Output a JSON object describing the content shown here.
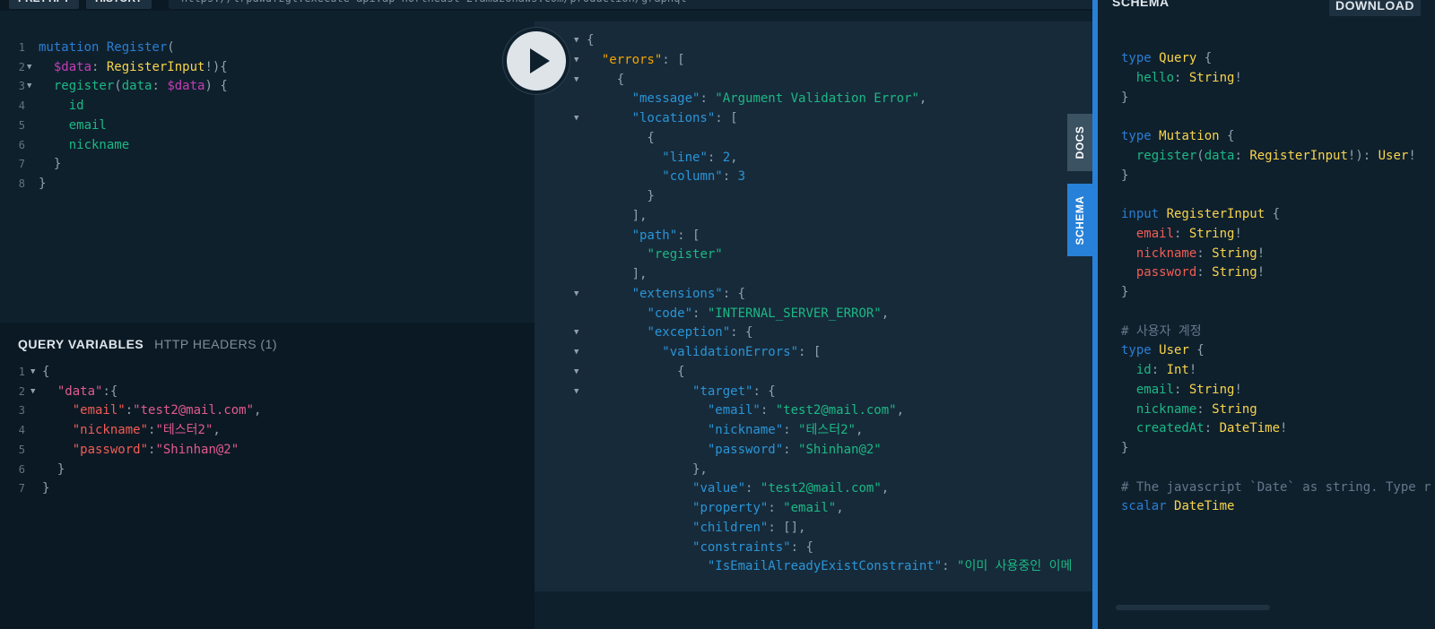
{
  "topbar": {
    "prettify": "PRETTIFY",
    "history": "HISTORY",
    "url": "https://lrpdwdfzgl.execute-api.ap-northeast-2.amazonaws.com/production/graphql"
  },
  "query_editor": {
    "lines": [
      {
        "n": "1",
        "fold": false,
        "tokens": [
          [
            "kw",
            "mutation "
          ],
          [
            "def",
            "Register"
          ],
          [
            "pun",
            "("
          ]
        ]
      },
      {
        "n": "2",
        "fold": true,
        "tokens": [
          [
            "pun",
            "  "
          ],
          [
            "var",
            "$data"
          ],
          [
            "pun",
            ": "
          ],
          [
            "typ",
            "RegisterInput"
          ],
          [
            "pun",
            "!){"
          ]
        ]
      },
      {
        "n": "3",
        "fold": true,
        "tokens": [
          [
            "pun",
            "  "
          ],
          [
            "fld",
            "register"
          ],
          [
            "pun",
            "("
          ],
          [
            "fld",
            "data"
          ],
          [
            "pun",
            ": "
          ],
          [
            "var",
            "$data"
          ],
          [
            "pun",
            ") {"
          ]
        ]
      },
      {
        "n": "4",
        "fold": false,
        "tokens": [
          [
            "pun",
            "    "
          ],
          [
            "fld",
            "id"
          ]
        ]
      },
      {
        "n": "5",
        "fold": false,
        "tokens": [
          [
            "pun",
            "    "
          ],
          [
            "fld",
            "email"
          ]
        ]
      },
      {
        "n": "6",
        "fold": false,
        "tokens": [
          [
            "pun",
            "    "
          ],
          [
            "fld",
            "nickname"
          ]
        ]
      },
      {
        "n": "7",
        "fold": false,
        "tokens": [
          [
            "pun",
            "  }"
          ]
        ]
      },
      {
        "n": "8",
        "fold": false,
        "tokens": [
          [
            "pun",
            "}"
          ]
        ]
      }
    ]
  },
  "variables": {
    "tab_query_variables": "QUERY VARIABLES",
    "tab_http_headers": "HTTP HEADERS (1)",
    "lines": [
      {
        "n": "1",
        "fold": true,
        "tokens": [
          [
            "pun",
            "{"
          ]
        ]
      },
      {
        "n": "2",
        "fold": true,
        "tokens": [
          [
            "pun",
            "  "
          ],
          [
            "strv",
            "\"data\""
          ],
          [
            "pun",
            ":{"
          ]
        ]
      },
      {
        "n": "3",
        "fold": false,
        "tokens": [
          [
            "pun",
            "    "
          ],
          [
            "strk",
            "\"email\""
          ],
          [
            "pun",
            ":"
          ],
          [
            "strv",
            "\"test2@mail.com\""
          ],
          [
            "pun",
            ","
          ]
        ]
      },
      {
        "n": "4",
        "fold": false,
        "tokens": [
          [
            "pun",
            "    "
          ],
          [
            "strk",
            "\"nickname\""
          ],
          [
            "pun",
            ":"
          ],
          [
            "strv",
            "\"테스터2\""
          ],
          [
            "pun",
            ","
          ]
        ]
      },
      {
        "n": "5",
        "fold": false,
        "tokens": [
          [
            "pun",
            "    "
          ],
          [
            "strk",
            "\"password\""
          ],
          [
            "pun",
            ":"
          ],
          [
            "strv",
            "\"Shinhan@2\""
          ]
        ]
      },
      {
        "n": "6",
        "fold": false,
        "tokens": [
          [
            "pun",
            "  }"
          ]
        ]
      },
      {
        "n": "7",
        "fold": false,
        "tokens": [
          [
            "pun",
            "}"
          ]
        ]
      }
    ]
  },
  "result": {
    "lines": [
      {
        "fold": true,
        "tokens": [
          [
            "pun",
            "{"
          ]
        ]
      },
      {
        "fold": true,
        "tokens": [
          [
            "pun",
            "  "
          ],
          [
            "jerr",
            "\"errors\""
          ],
          [
            "pun",
            ": ["
          ]
        ]
      },
      {
        "fold": true,
        "tokens": [
          [
            "pun",
            "    {"
          ]
        ]
      },
      {
        "fold": false,
        "tokens": [
          [
            "pun",
            "      "
          ],
          [
            "jkey",
            "\"message\""
          ],
          [
            "pun",
            ": "
          ],
          [
            "jstr",
            "\"Argument Validation Error\""
          ],
          [
            "pun",
            ","
          ]
        ]
      },
      {
        "fold": true,
        "tokens": [
          [
            "pun",
            "      "
          ],
          [
            "jkey",
            "\"locations\""
          ],
          [
            "pun",
            ": ["
          ]
        ]
      },
      {
        "fold": false,
        "tokens": [
          [
            "pun",
            "        {"
          ]
        ]
      },
      {
        "fold": false,
        "tokens": [
          [
            "pun",
            "          "
          ],
          [
            "jkey",
            "\"line\""
          ],
          [
            "pun",
            ": "
          ],
          [
            "jnum",
            "2"
          ],
          [
            "pun",
            ","
          ]
        ]
      },
      {
        "fold": false,
        "tokens": [
          [
            "pun",
            "          "
          ],
          [
            "jkey",
            "\"column\""
          ],
          [
            "pun",
            ": "
          ],
          [
            "jnum",
            "3"
          ]
        ]
      },
      {
        "fold": false,
        "tokens": [
          [
            "pun",
            "        }"
          ]
        ]
      },
      {
        "fold": false,
        "tokens": [
          [
            "pun",
            "      ],"
          ]
        ]
      },
      {
        "fold": false,
        "tokens": [
          [
            "pun",
            "      "
          ],
          [
            "jkey",
            "\"path\""
          ],
          [
            "pun",
            ": ["
          ]
        ]
      },
      {
        "fold": false,
        "tokens": [
          [
            "pun",
            "        "
          ],
          [
            "jstr",
            "\"register\""
          ]
        ]
      },
      {
        "fold": false,
        "tokens": [
          [
            "pun",
            "      ],"
          ]
        ]
      },
      {
        "fold": true,
        "tokens": [
          [
            "pun",
            "      "
          ],
          [
            "jkey",
            "\"extensions\""
          ],
          [
            "pun",
            ": {"
          ]
        ]
      },
      {
        "fold": false,
        "tokens": [
          [
            "pun",
            "        "
          ],
          [
            "jkey",
            "\"code\""
          ],
          [
            "pun",
            ": "
          ],
          [
            "jstr",
            "\"INTERNAL_SERVER_ERROR\""
          ],
          [
            "pun",
            ","
          ]
        ]
      },
      {
        "fold": true,
        "tokens": [
          [
            "pun",
            "        "
          ],
          [
            "jkey",
            "\"exception\""
          ],
          [
            "pun",
            ": {"
          ]
        ]
      },
      {
        "fold": true,
        "tokens": [
          [
            "pun",
            "          "
          ],
          [
            "jkey",
            "\"validationErrors\""
          ],
          [
            "pun",
            ": ["
          ]
        ]
      },
      {
        "fold": true,
        "tokens": [
          [
            "pun",
            "            {"
          ]
        ]
      },
      {
        "fold": true,
        "tokens": [
          [
            "pun",
            "              "
          ],
          [
            "jkey",
            "\"target\""
          ],
          [
            "pun",
            ": {"
          ]
        ]
      },
      {
        "fold": false,
        "tokens": [
          [
            "pun",
            "                "
          ],
          [
            "jkey",
            "\"email\""
          ],
          [
            "pun",
            ": "
          ],
          [
            "jstr",
            "\"test2@mail.com\""
          ],
          [
            "pun",
            ","
          ]
        ]
      },
      {
        "fold": false,
        "tokens": [
          [
            "pun",
            "                "
          ],
          [
            "jkey",
            "\"nickname\""
          ],
          [
            "pun",
            ": "
          ],
          [
            "jstr",
            "\"테스터2\""
          ],
          [
            "pun",
            ","
          ]
        ]
      },
      {
        "fold": false,
        "tokens": [
          [
            "pun",
            "                "
          ],
          [
            "jkey",
            "\"password\""
          ],
          [
            "pun",
            ": "
          ],
          [
            "jstr",
            "\"Shinhan@2\""
          ]
        ]
      },
      {
        "fold": false,
        "tokens": [
          [
            "pun",
            "              },"
          ]
        ]
      },
      {
        "fold": false,
        "tokens": [
          [
            "pun",
            "              "
          ],
          [
            "jkey",
            "\"value\""
          ],
          [
            "pun",
            ": "
          ],
          [
            "jstr",
            "\"test2@mail.com\""
          ],
          [
            "pun",
            ","
          ]
        ]
      },
      {
        "fold": false,
        "tokens": [
          [
            "pun",
            "              "
          ],
          [
            "jkey",
            "\"property\""
          ],
          [
            "pun",
            ": "
          ],
          [
            "jstr",
            "\"email\""
          ],
          [
            "pun",
            ","
          ]
        ]
      },
      {
        "fold": false,
        "tokens": [
          [
            "pun",
            "              "
          ],
          [
            "jkey",
            "\"children\""
          ],
          [
            "pun",
            ": [],"
          ]
        ]
      },
      {
        "fold": false,
        "tokens": [
          [
            "pun",
            "              "
          ],
          [
            "jkey",
            "\"constraints\""
          ],
          [
            "pun",
            ": {"
          ]
        ]
      },
      {
        "fold": false,
        "tokens": [
          [
            "pun",
            "                "
          ],
          [
            "jkey",
            "\"IsEmailAlreadyExistConstraint\""
          ],
          [
            "pun",
            ": "
          ],
          [
            "jstr",
            "\"이미 사용중인 이메"
          ]
        ]
      }
    ]
  },
  "side_tabs": {
    "docs": "DOCS",
    "schema": "SCHEMA"
  },
  "schema": {
    "title": "SCHEMA",
    "download": "DOWNLOAD",
    "lines": [
      {
        "tokens": [
          [
            "kw",
            "type "
          ],
          [
            "typ",
            "Query"
          ],
          [
            "pun",
            " {"
          ]
        ]
      },
      {
        "tokens": [
          [
            "pun",
            "  "
          ],
          [
            "fld",
            "hello"
          ],
          [
            "pun",
            ": "
          ],
          [
            "typ",
            "String"
          ],
          [
            "pun",
            "!"
          ]
        ]
      },
      {
        "tokens": [
          [
            "pun",
            "}"
          ]
        ]
      },
      {
        "tokens": []
      },
      {
        "tokens": [
          [
            "kw",
            "type "
          ],
          [
            "typ",
            "Mutation"
          ],
          [
            "pun",
            " {"
          ]
        ]
      },
      {
        "tokens": [
          [
            "pun",
            "  "
          ],
          [
            "fld",
            "register"
          ],
          [
            "pun",
            "("
          ],
          [
            "fld",
            "data"
          ],
          [
            "pun",
            ": "
          ],
          [
            "typ",
            "RegisterInput"
          ],
          [
            "pun",
            "!): "
          ],
          [
            "typ",
            "User"
          ],
          [
            "pun",
            "!"
          ]
        ]
      },
      {
        "tokens": [
          [
            "pun",
            "}"
          ]
        ]
      },
      {
        "tokens": []
      },
      {
        "tokens": [
          [
            "kw",
            "input "
          ],
          [
            "typ",
            "RegisterInput"
          ],
          [
            "pun",
            " {"
          ]
        ]
      },
      {
        "tokens": [
          [
            "pun",
            "  "
          ],
          [
            "strk",
            "email"
          ],
          [
            "pun",
            ": "
          ],
          [
            "typ",
            "String"
          ],
          [
            "pun",
            "!"
          ]
        ]
      },
      {
        "tokens": [
          [
            "pun",
            "  "
          ],
          [
            "strk",
            "nickname"
          ],
          [
            "pun",
            ": "
          ],
          [
            "typ",
            "String"
          ],
          [
            "pun",
            "!"
          ]
        ]
      },
      {
        "tokens": [
          [
            "pun",
            "  "
          ],
          [
            "strk",
            "password"
          ],
          [
            "pun",
            ": "
          ],
          [
            "typ",
            "String"
          ],
          [
            "pun",
            "!"
          ]
        ]
      },
      {
        "tokens": [
          [
            "pun",
            "}"
          ]
        ]
      },
      {
        "tokens": []
      },
      {
        "tokens": [
          [
            "cmt",
            "# 사용자 계정"
          ]
        ]
      },
      {
        "tokens": [
          [
            "kw",
            "type "
          ],
          [
            "typ",
            "User"
          ],
          [
            "pun",
            " {"
          ]
        ]
      },
      {
        "tokens": [
          [
            "pun",
            "  "
          ],
          [
            "fld",
            "id"
          ],
          [
            "pun",
            ": "
          ],
          [
            "typ",
            "Int"
          ],
          [
            "pun",
            "!"
          ]
        ]
      },
      {
        "tokens": [
          [
            "pun",
            "  "
          ],
          [
            "fld",
            "email"
          ],
          [
            "pun",
            ": "
          ],
          [
            "typ",
            "String"
          ],
          [
            "pun",
            "!"
          ]
        ]
      },
      {
        "tokens": [
          [
            "pun",
            "  "
          ],
          [
            "fld",
            "nickname"
          ],
          [
            "pun",
            ": "
          ],
          [
            "typ",
            "String"
          ]
        ]
      },
      {
        "tokens": [
          [
            "pun",
            "  "
          ],
          [
            "fld",
            "createdAt"
          ],
          [
            "pun",
            ": "
          ],
          [
            "typ",
            "DateTime"
          ],
          [
            "pun",
            "!"
          ]
        ]
      },
      {
        "tokens": [
          [
            "pun",
            "}"
          ]
        ]
      },
      {
        "tokens": []
      },
      {
        "tokens": [
          [
            "cmt",
            "# The javascript `Date` as string. Type r"
          ]
        ]
      },
      {
        "tokens": [
          [
            "kw",
            "scalar "
          ],
          [
            "typ",
            "DateTime"
          ]
        ]
      }
    ]
  }
}
